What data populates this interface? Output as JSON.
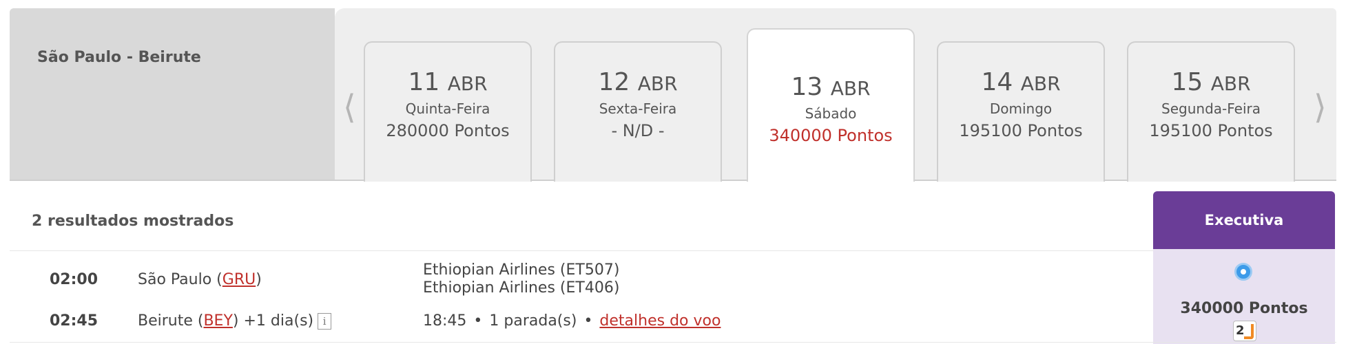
{
  "route": {
    "title": "São Paulo - Beirute"
  },
  "nav": {
    "prev_icon": "chevron-left-icon",
    "next_icon": "chevron-right-icon",
    "prev": "⟨",
    "next": "⟩"
  },
  "dates": [
    {
      "day": "11",
      "month": "ABR",
      "weekday": "Quinta-Feira",
      "points": "280000 Pontos",
      "selected": false
    },
    {
      "day": "12",
      "month": "ABR",
      "weekday": "Sexta-Feira",
      "points": "- N/D -",
      "selected": false
    },
    {
      "day": "13",
      "month": "ABR",
      "weekday": "Sábado",
      "points": "340000 Pontos",
      "selected": true
    },
    {
      "day": "14",
      "month": "ABR",
      "weekday": "Domingo",
      "points": "195100 Pontos",
      "selected": false
    },
    {
      "day": "15",
      "month": "ABR",
      "weekday": "Segunda-Feira",
      "points": "195100 Pontos",
      "selected": false
    }
  ],
  "results": {
    "count_label": "2 resultados mostrados",
    "cabin_label": "Executiva",
    "flight": {
      "depart_time": "02:00",
      "depart_city": "São Paulo (",
      "depart_code": "GRU",
      "depart_close": ")",
      "arrive_time": "02:45",
      "arrive_city": "Beirute (",
      "arrive_code": "BEY",
      "arrive_close": ")",
      "next_day": "+1 dia(s)",
      "info_glyph": "i",
      "segments": [
        "Ethiopian Airlines (ET507)",
        "Ethiopian Airlines (ET406)"
      ],
      "duration": "18:45",
      "stops": "1 parada(s)",
      "details_link": "detalhes do voo",
      "cabin_points": "340000 Pontos",
      "seats_left": "2"
    }
  },
  "colors": {
    "accent_purple": "#6a3d97",
    "selected_red": "#c0302b",
    "radio_blue": "#3d9be9"
  }
}
